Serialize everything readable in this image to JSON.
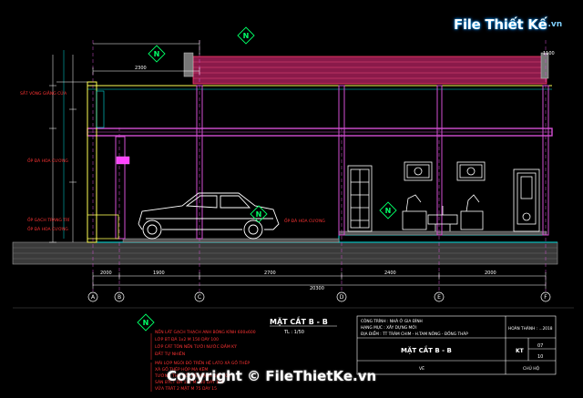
{
  "watermark": {
    "logo_main": "File Thiết Kế",
    "logo_domain": ".vn",
    "copyright": "Copyright © FileThietKe.vn"
  },
  "section": {
    "title": "MẶT CẮT B - B",
    "scale": "TL : 1/50"
  },
  "north_marker": {
    "label": "N"
  },
  "dimensions": {
    "top_left": "2300",
    "top_right": "1100",
    "bottom_total": "20300",
    "bottom_1": "2000",
    "bottom_2": "1900",
    "bottom_3": "2700",
    "bottom_4": "2400",
    "bottom_5": "2000"
  },
  "axes": [
    "A",
    "B",
    "C",
    "D",
    "E",
    "F"
  ],
  "annotations": {
    "left_top": "SẮT VÒNG GIẰNG CỬA",
    "left_mid": "ỐP ĐÁ HOA CƯƠNG",
    "left_low1": "ỐP GẠCH TRANG TRÍ",
    "left_low2": "ỐP ĐÁ HOA CƯƠNG",
    "right_stone": "ỐP ĐÁ HOA CƯƠNG"
  },
  "notes": [
    "NỀN LÁT GẠCH THẠCH ANH BÓNG KÍNH 600x600",
    "LỚP BT ĐÁ 1x2 M 150 DÀY 100",
    "LỚP CÁT TÔN NỀN TƯỚI NƯỚC ĐẦM KỸ",
    "ĐẤT TỰ NHIÊN",
    "MÁI LỢP NGÓI ĐỎ TRÊN HỆ LATO XÀ GỒ THÉP",
    "XÀ GỒ THÉP HỘP MẠ KẼM",
    "TƯỜNG THU HỒI XÂY GẠCH DÀY 100",
    "SÀN BTCT ĐÁ 1x2 M 250 DÀY 100",
    "VỮA TRÁT 2 MẶT M 75 DÀY 15"
  ],
  "title_block": {
    "project": "CÔNG TRÌNH : NHÀ Ở GIA ĐÌNH",
    "item": "HẠNG MỤC : XÂY DỰNG MỚI",
    "location": "ĐỊA ĐIỂM : TT TRÀM CHIM - H.TAM NÔNG - ĐỒNG THÁP",
    "completion": "HOÀN THÀNH : ...2018",
    "drawing_name": "MẶT CẮT B - B",
    "sheet_code": "KT",
    "sheet_num": "07",
    "sheet_total": "10",
    "drawn_label": "VẼ",
    "owner_label": "CHỦ HỘ"
  }
}
